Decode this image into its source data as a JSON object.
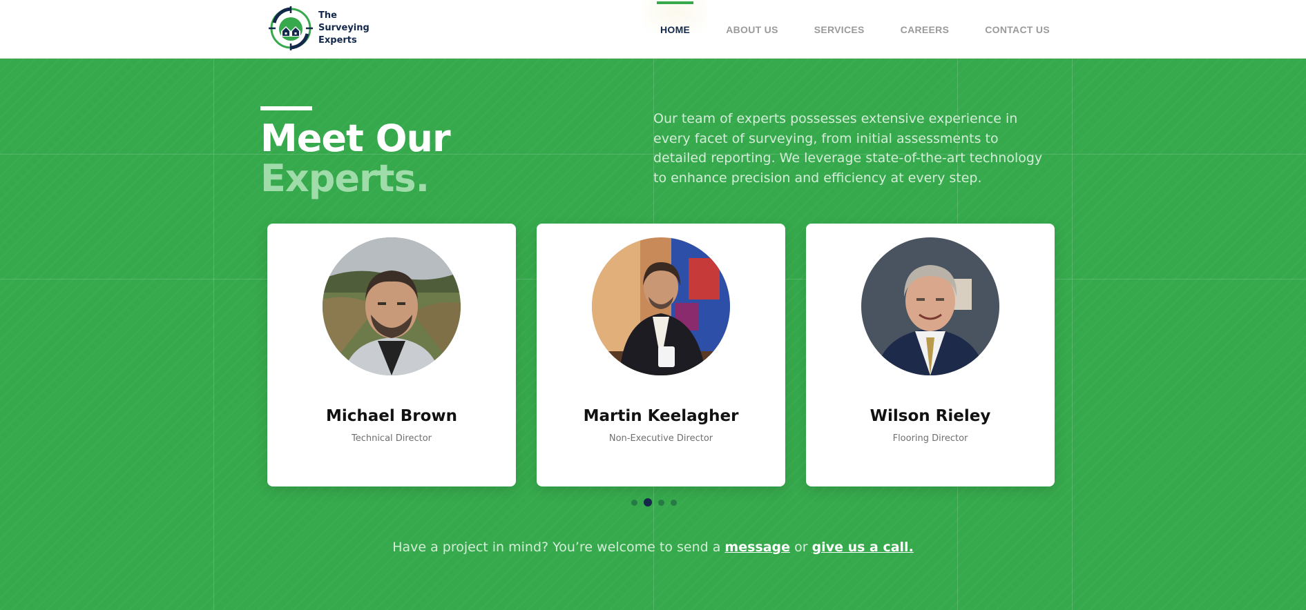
{
  "brand": {
    "logo_line1": "The",
    "logo_line2": "Surveying",
    "logo_line3": "Experts",
    "colors": {
      "green": "#36a94c",
      "navy": "#14284b",
      "light_green": "#9fdcaa"
    }
  },
  "nav": {
    "items": [
      {
        "label": "HOME",
        "active": true
      },
      {
        "label": "ABOUT US",
        "active": false
      },
      {
        "label": "SERVICES",
        "active": false
      },
      {
        "label": "CAREERS",
        "active": false
      },
      {
        "label": "CONTACT US",
        "active": false
      }
    ]
  },
  "team": {
    "title_line1": "Meet Our",
    "title_line2": "Experts.",
    "intro": "Our team of experts possesses extensive experience in every facet of surveying, from initial assessments to detailed reporting. We leverage state-of-the-art technology to enhance precision and efficiency at every step.",
    "members": [
      {
        "name": "Michael Brown",
        "role": "Technical Director",
        "photo": "portrait-outdoor-man"
      },
      {
        "name": "Martin Keelagher",
        "role": "Non-Executive Director",
        "photo": "portrait-man-with-mug"
      },
      {
        "name": "Wilson Rieley",
        "role": "Flooring Director",
        "photo": "portrait-man-in-suit"
      }
    ],
    "carousel": {
      "total_pages": 4,
      "active_page": 2
    }
  },
  "cta": {
    "text": "Have a project in mind? You’re welcome to send a",
    "message_link": "message",
    "or": "or",
    "call_link": "give us a call."
  }
}
